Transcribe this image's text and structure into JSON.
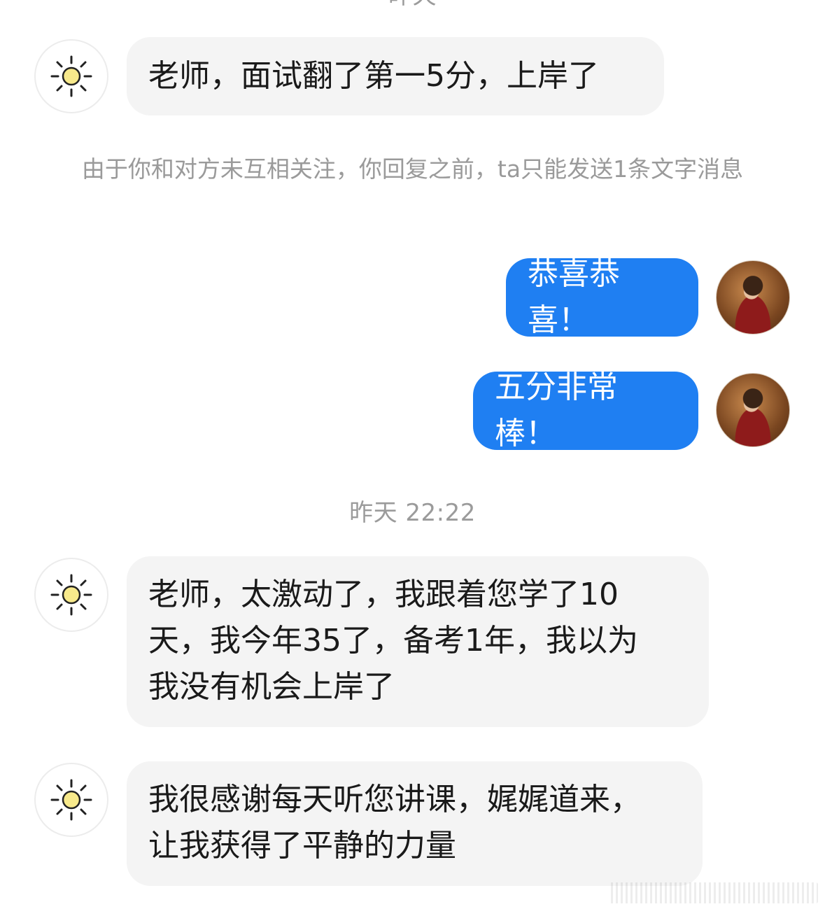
{
  "timestamps": {
    "top": "昨天",
    "middle": "昨天 22:22"
  },
  "notice": "由于你和对方未互相关注，你回复之前，ta只能发送1条文字消息",
  "messages": {
    "m1": "老师，面试翻了第一5分，上岸了",
    "m2": "恭喜恭喜！",
    "m3": "五分非常棒！",
    "m4": [
      "老师，太激动了，我跟着您学了10",
      "天，我今年35了，备考1年，我以为",
      "我没有机会上岸了"
    ],
    "m5": [
      "我很感谢每天听您讲课，娓娓道来，",
      "让我获得了平静的力量"
    ]
  },
  "icons": {
    "contact_avatar": "sun-icon",
    "user_avatar": "portrait-photo"
  },
  "colors": {
    "outgoing_bubble": "#1f7ff2",
    "incoming_bubble": "#f4f4f4",
    "meta_text": "#9b9b9b"
  }
}
